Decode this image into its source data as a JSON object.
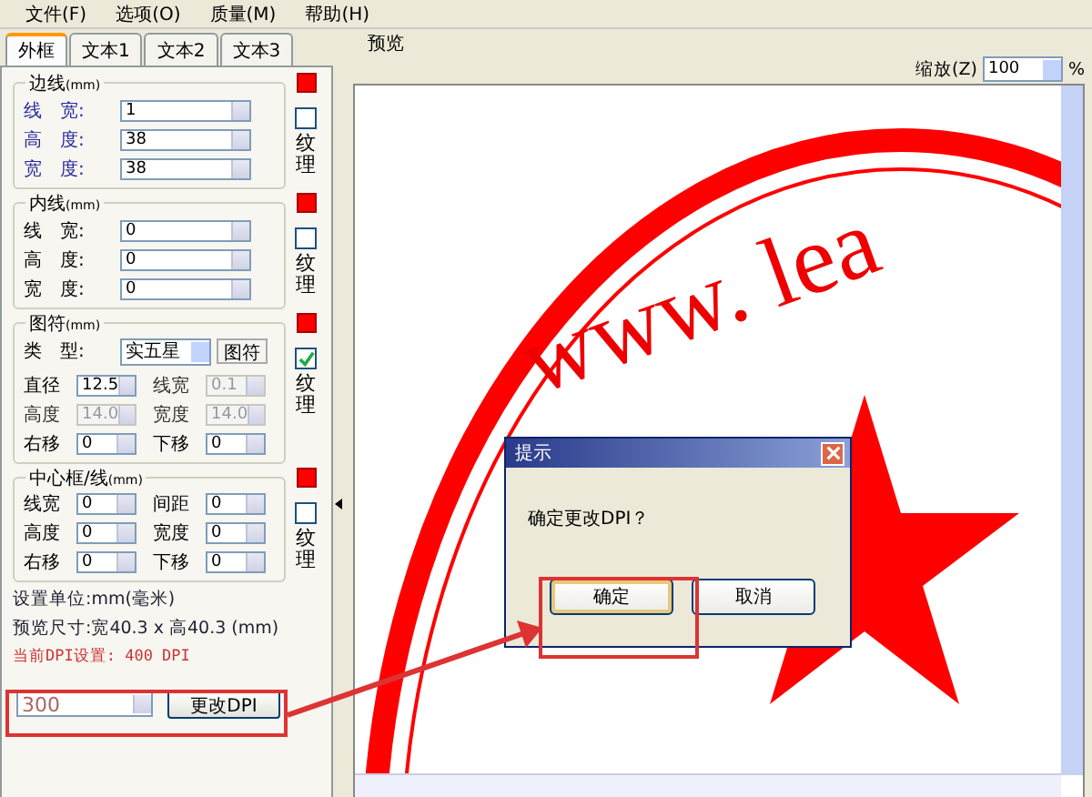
{
  "menu": [
    "文件(F)",
    "选项(O)",
    "质量(M)",
    "帮助(H)"
  ],
  "tabs": [
    {
      "label": "外框",
      "selected": true
    },
    {
      "label": "文本1",
      "selected": false
    },
    {
      "label": "文本2",
      "selected": false
    },
    {
      "label": "文本3",
      "selected": false
    }
  ],
  "groups": [
    {
      "kind": "list",
      "title": "边线",
      "unit": "(mm)",
      "texture": {
        "label": "纹理",
        "checked": false
      },
      "fields": [
        {
          "label": "线　宽:",
          "value": "1",
          "disabled": false
        },
        {
          "label": "高　度:",
          "value": "38",
          "disabled": false
        },
        {
          "label": "宽　度:",
          "value": "38",
          "disabled": false
        }
      ]
    },
    {
      "kind": "list",
      "title": "内线",
      "unit": "(mm)",
      "texture": {
        "label": "纹理",
        "checked": false
      },
      "fields": [
        {
          "label": "线　宽:",
          "value": "0",
          "disabled": false
        },
        {
          "label": "高　度:",
          "value": "0",
          "disabled": false
        },
        {
          "label": "宽　度:",
          "value": "0",
          "disabled": false
        }
      ]
    },
    {
      "kind": "grid",
      "title": "图符",
      "unit": "(mm)",
      "texture": {
        "label": "纹理",
        "checked": true
      },
      "type_label": "类　型:",
      "type_value": "实五星",
      "type_button": "图符",
      "fields": [
        {
          "label": "直径",
          "value": "12.5",
          "disabled": false
        },
        {
          "label": "线宽",
          "value": "0.1",
          "disabled": true
        },
        {
          "label": "高度",
          "value": "14.0",
          "disabled": true
        },
        {
          "label": "宽度",
          "value": "14.0",
          "disabled": true
        },
        {
          "label": "右移",
          "value": "0",
          "disabled": false
        },
        {
          "label": "下移",
          "value": "0",
          "disabled": false
        }
      ]
    },
    {
      "kind": "grid",
      "title": "中心框/线",
      "unit": "(mm)",
      "texture": {
        "label": "纹理",
        "checked": false
      },
      "fields": [
        {
          "label": "线宽",
          "value": "0",
          "disabled": false
        },
        {
          "label": "间距",
          "value": "0",
          "disabled": false
        },
        {
          "label": "高度",
          "value": "0",
          "disabled": false
        },
        {
          "label": "宽度",
          "value": "0",
          "disabled": false
        },
        {
          "label": "右移",
          "value": "0",
          "disabled": false
        },
        {
          "label": "下移",
          "value": "0",
          "disabled": false
        }
      ]
    }
  ],
  "info": [
    "设置单位:mm(毫米)",
    "预览尺寸:宽40.3 x 高40.3 (mm)"
  ],
  "dpi_current": "当前DPI设置: 400 DPI",
  "dpi_input": "300",
  "dpi_button": "更改DPI",
  "preview": {
    "title": "预览",
    "zoom_label": "缩放(Z)",
    "zoom_value": "100",
    "zoom_unit": "%",
    "stamp_text": "www. lea"
  },
  "dialog": {
    "title": "提示",
    "message": "确定更改DPI？",
    "buttons": [
      {
        "label": "确定",
        "selected": true
      },
      {
        "label": "取消",
        "selected": false
      }
    ]
  }
}
